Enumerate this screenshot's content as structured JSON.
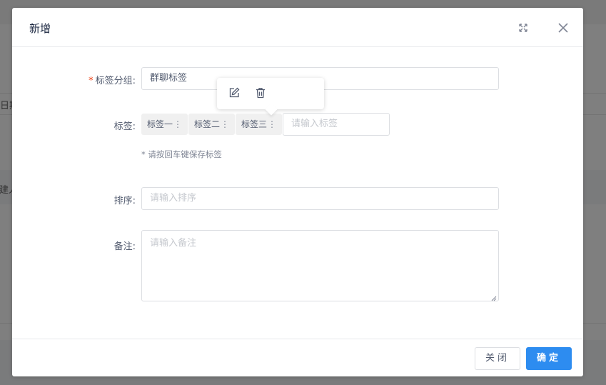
{
  "background": {
    "row_text_1": "日期",
    "row_text_2": "创建人"
  },
  "dialog": {
    "title": "新增",
    "icons": {
      "fullscreen": "fullscreen-icon",
      "close": "close-icon"
    },
    "form": {
      "group_label": "标签分组:",
      "group_required_mark": "*",
      "group_value": "群聊标签",
      "tags_label": "标签:",
      "tags": [
        {
          "label": "标签一"
        },
        {
          "label": "标签二"
        },
        {
          "label": "标签三"
        }
      ],
      "tag_menu_glyph": "⋮",
      "tag_input_placeholder": "请输入标签",
      "tag_hint": "* 请按回车键保存标签",
      "sort_label": "排序:",
      "sort_placeholder": "请输入排序",
      "remark_label": "备注:",
      "remark_placeholder": "请输入备注"
    },
    "popover": {
      "icons": [
        "edit-icon",
        "delete-icon"
      ]
    },
    "footer": {
      "close_label": "关闭",
      "confirm_label": "确定"
    }
  },
  "colors": {
    "primary": "#2d8cf0",
    "required": "#ed4014",
    "mask": "rgba(0,0,0,0.5)"
  }
}
